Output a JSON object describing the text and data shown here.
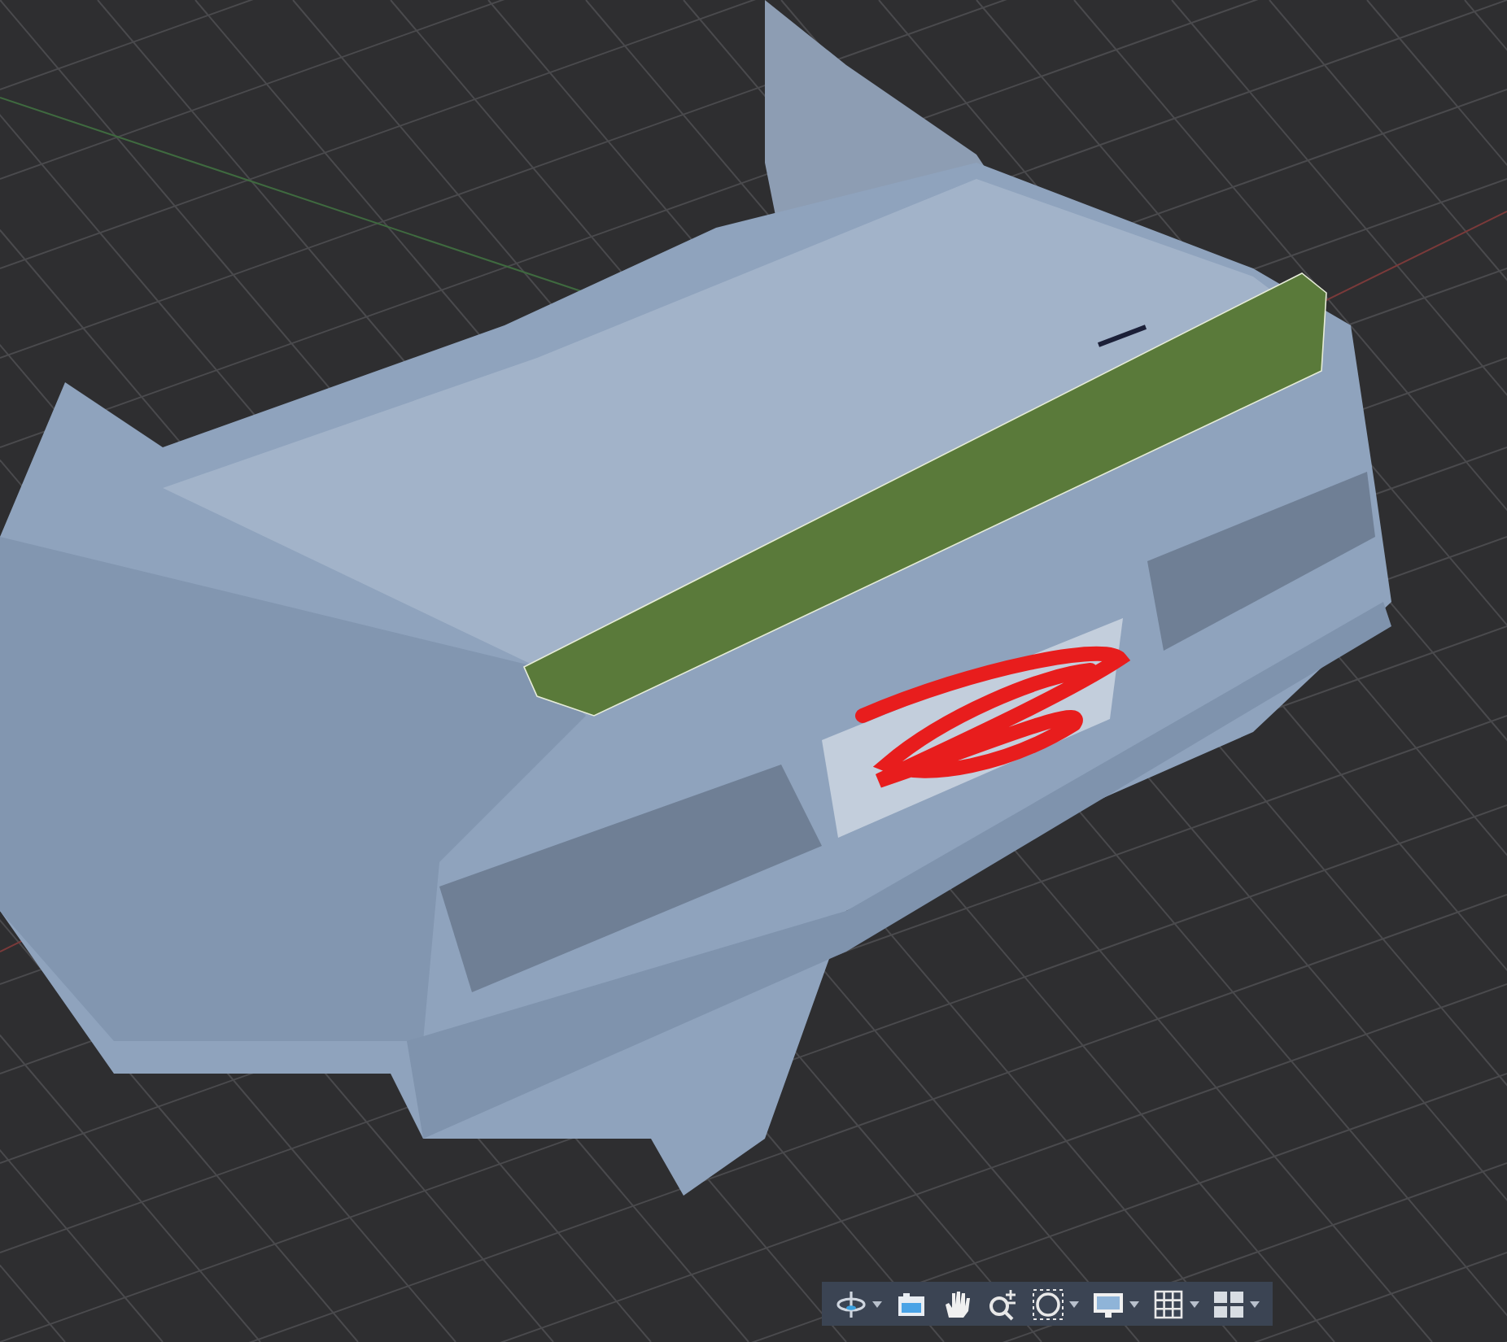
{
  "toolbar": {
    "tools": [
      {
        "kind": "orbit",
        "dropdown": true
      },
      {
        "kind": "camera",
        "dropdown": false
      },
      {
        "kind": "pan",
        "dropdown": false
      },
      {
        "kind": "zoom",
        "dropdown": false
      },
      {
        "kind": "zoom_window",
        "dropdown": true
      },
      {
        "kind": "display",
        "dropdown": true
      },
      {
        "kind": "grid",
        "dropdown": true
      },
      {
        "kind": "viewports",
        "dropdown": true
      }
    ]
  }
}
